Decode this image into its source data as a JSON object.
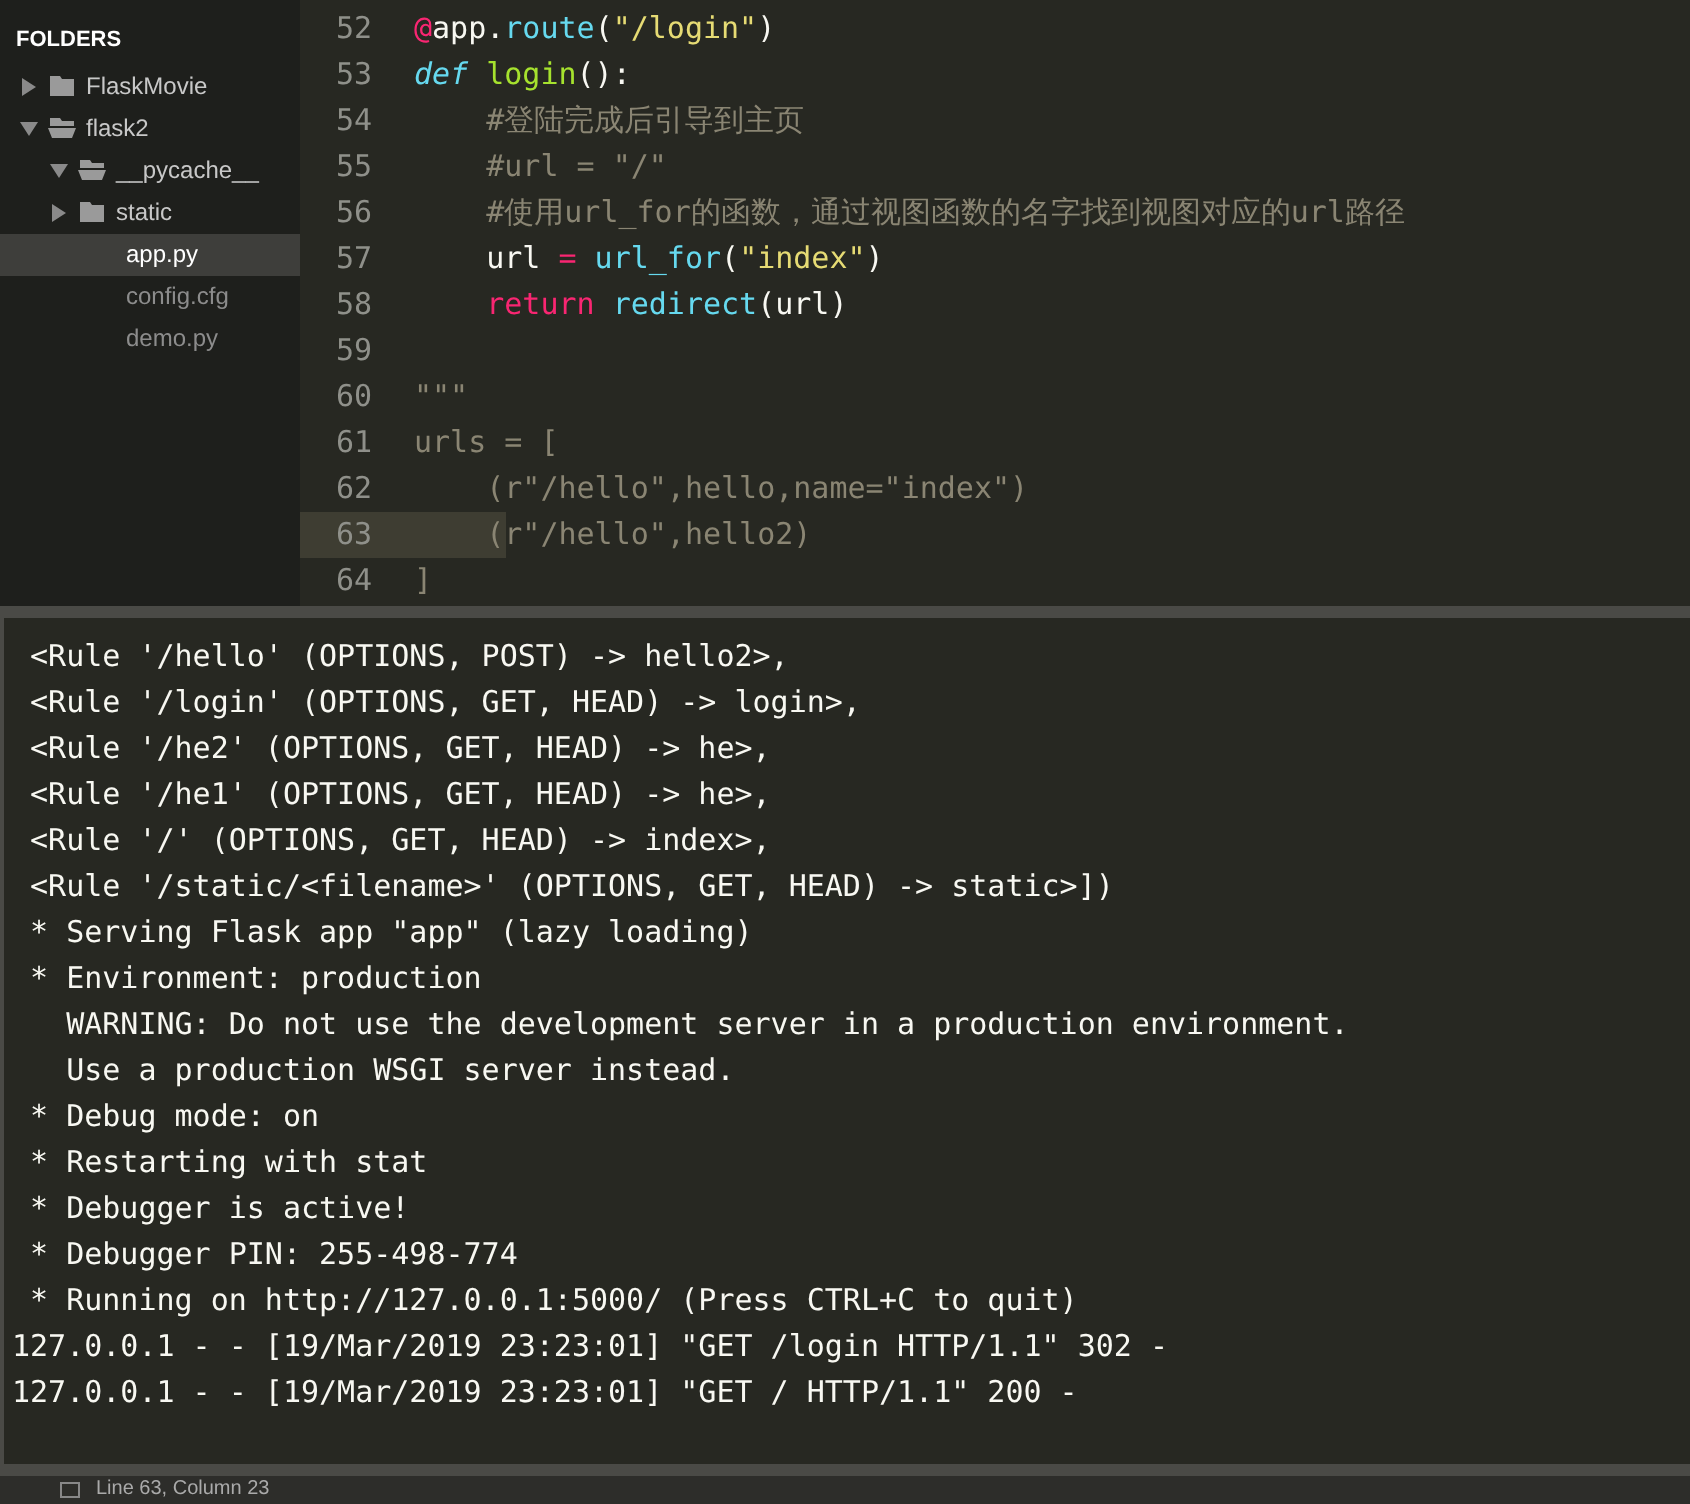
{
  "sidebar": {
    "heading": "FOLDERS",
    "tree": [
      {
        "label": "FlaskMovie",
        "kind": "folder",
        "expanded": false,
        "selected": false
      },
      {
        "label": "flask2",
        "kind": "folder",
        "expanded": true,
        "selected": false,
        "children": [
          {
            "label": "__pycache__",
            "kind": "folder",
            "expanded": true,
            "selected": false
          },
          {
            "label": "static",
            "kind": "folder",
            "expanded": false,
            "selected": false
          },
          {
            "label": "app.py",
            "kind": "file",
            "selected": true
          },
          {
            "label": "config.cfg",
            "kind": "file",
            "selected": false
          },
          {
            "label": "demo.py",
            "kind": "file",
            "selected": false
          }
        ]
      }
    ]
  },
  "editor": {
    "lines": [
      {
        "number": "52",
        "current": false,
        "tokens": [
          {
            "text": "@",
            "kind": "keyword"
          },
          {
            "text": "app.",
            "kind": "plain"
          },
          {
            "text": "route",
            "kind": "call"
          },
          {
            "text": "(",
            "kind": "plain"
          },
          {
            "text": "\"/login\"",
            "kind": "string"
          },
          {
            "text": ")",
            "kind": "plain"
          }
        ]
      },
      {
        "number": "53",
        "current": false,
        "tokens": [
          {
            "text": "def",
            "kind": "storage"
          },
          {
            "text": " login",
            "kind": "name"
          },
          {
            "text": "():",
            "kind": "plain"
          }
        ]
      },
      {
        "number": "54",
        "current": false,
        "tokens": [
          {
            "text": "    #登陆完成后引导到主页",
            "kind": "comment"
          }
        ]
      },
      {
        "number": "55",
        "current": false,
        "tokens": [
          {
            "text": "    #url = \"/\"",
            "kind": "comment"
          }
        ]
      },
      {
        "number": "56",
        "current": false,
        "tokens": [
          {
            "text": "    #使用url_for的函数，通过视图函数的名字找到视图对应的url路径",
            "kind": "comment"
          }
        ]
      },
      {
        "number": "57",
        "current": false,
        "tokens": [
          {
            "text": "    url ",
            "kind": "plain"
          },
          {
            "text": "=",
            "kind": "keyword"
          },
          {
            "text": " url_for",
            "kind": "call"
          },
          {
            "text": "(",
            "kind": "plain"
          },
          {
            "text": "\"index\"",
            "kind": "string"
          },
          {
            "text": ")",
            "kind": "plain"
          }
        ]
      },
      {
        "number": "58",
        "current": false,
        "tokens": [
          {
            "text": "    return",
            "kind": "keyword"
          },
          {
            "text": " redirect",
            "kind": "call"
          },
          {
            "text": "(url)",
            "kind": "plain"
          }
        ]
      },
      {
        "number": "59",
        "current": false
      },
      {
        "number": "60",
        "current": false,
        "tokens": [
          {
            "text": "\"\"\"",
            "kind": "comment"
          }
        ]
      },
      {
        "number": "61",
        "current": false,
        "tokens": [
          {
            "text": "urls = [",
            "kind": "comment"
          }
        ]
      },
      {
        "number": "62",
        "current": false,
        "tokens": [
          {
            "text": "    (r\"/hello\",hello,name=\"index\")",
            "kind": "comment"
          }
        ]
      },
      {
        "number": "63",
        "current": true,
        "tokens": [
          {
            "text": "    (r\"/hello\",hello2)",
            "kind": "comment"
          }
        ]
      },
      {
        "number": "64",
        "current": false,
        "tokens": [
          {
            "text": "]",
            "kind": "comment"
          }
        ]
      }
    ]
  },
  "console": {
    "lines": [
      " <Rule '/hello' (OPTIONS, POST) -> hello2>,",
      " <Rule '/login' (OPTIONS, GET, HEAD) -> login>,",
      " <Rule '/he2' (OPTIONS, GET, HEAD) -> he>,",
      " <Rule '/he1' (OPTIONS, GET, HEAD) -> he>,",
      " <Rule '/' (OPTIONS, GET, HEAD) -> index>,",
      " <Rule '/static/<filename>' (OPTIONS, GET, HEAD) -> static>])",
      " * Serving Flask app \"app\" (lazy loading)",
      " * Environment: production",
      "   WARNING: Do not use the development server in a production environment.",
      "   Use a production WSGI server instead.",
      " * Debug mode: on",
      " * Restarting with stat",
      " * Debugger is active!",
      " * Debugger PIN: 255-498-774",
      " * Running on http://127.0.0.1:5000/ (Press CTRL+C to quit)",
      "127.0.0.1 - - [19/Mar/2019 23:23:01] \"GET /login HTTP/1.1\" 302 -",
      "127.0.0.1 - - [19/Mar/2019 23:23:01] \"GET / HTTP/1.1\" 200 -"
    ]
  },
  "status_bar": {
    "text": "Line 63, Column 23"
  }
}
